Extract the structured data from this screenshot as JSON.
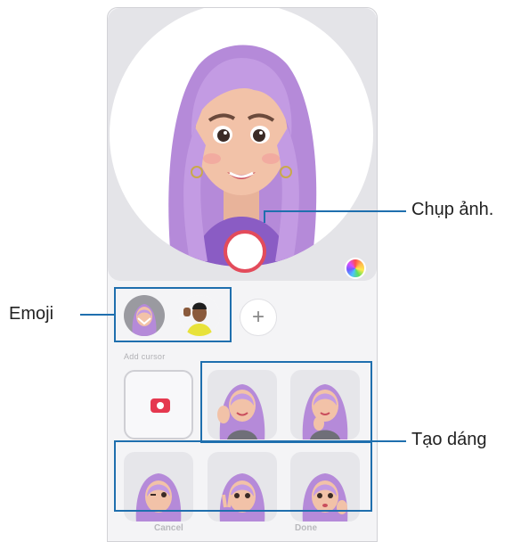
{
  "callouts": {
    "capture": "Chụp ảnh.",
    "emoji": "Emoji",
    "pose": "Tạo dáng"
  },
  "emoji_panel": {
    "add_symbol": "+",
    "section_label": "Add cursor"
  },
  "pose_cells": [
    "wave-pose-sticker",
    "peace-pose-sticker",
    "wink-pose-sticker",
    "v-sign-pose-sticker",
    "pout-pose-sticker"
  ],
  "buttons": {
    "cancel": "Cancel",
    "done": "Done"
  },
  "colors": {
    "shutter_ring": "#e34b5b",
    "callout_line": "#1f6fae",
    "hair": "#b58ad9",
    "camera_icon": "#e5384f"
  }
}
